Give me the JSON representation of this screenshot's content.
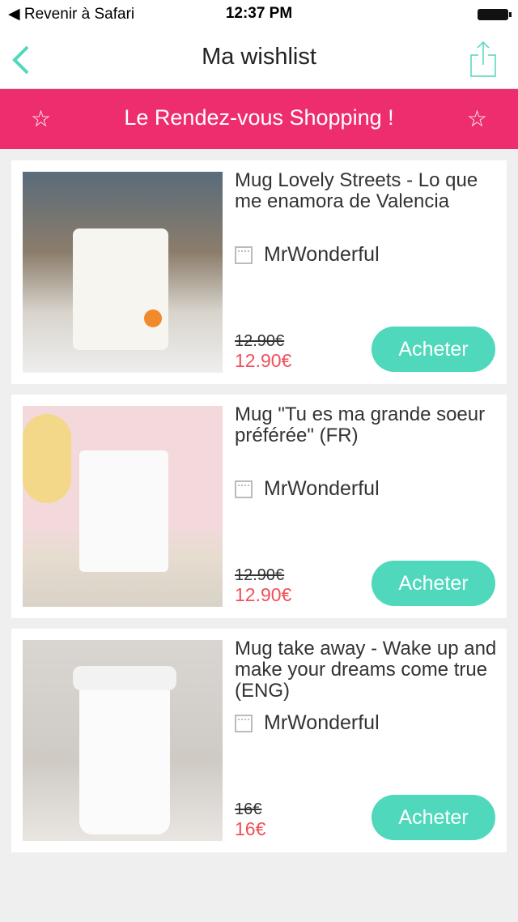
{
  "status": {
    "back": "◀ Revenir à Safari",
    "time": "12:37 PM"
  },
  "nav": {
    "title": "Ma wishlist"
  },
  "banner": {
    "text": "Le Rendez-vous Shopping !",
    "star": "☆"
  },
  "colors": {
    "accent": "#4fd8bb",
    "banner": "#ee2d6e",
    "price": "#f0505a"
  },
  "items": [
    {
      "name": "Mug Lovely Streets - Lo que me enamora de Valencia",
      "shop": "MrWonderful",
      "old_price": "12.90€",
      "price": "12.90€",
      "button": "Acheter"
    },
    {
      "name": "Mug \"Tu es ma grande soeur préférée\" (FR)",
      "shop": "MrWonderful",
      "old_price": "12.90€",
      "price": "12.90€",
      "button": "Acheter"
    },
    {
      "name": "Mug take away - Wake up and make your dreams come true (ENG)",
      "shop": "MrWonderful",
      "old_price": "16€",
      "price": "16€",
      "button": "Acheter"
    }
  ]
}
